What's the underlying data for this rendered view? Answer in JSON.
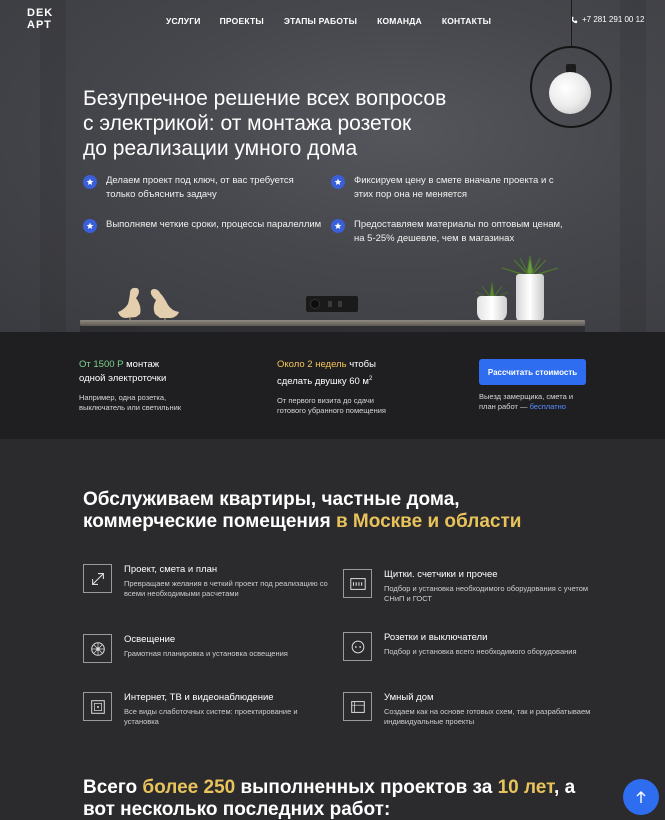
{
  "header": {
    "logo_line1": "DEK",
    "logo_line2": "АРТ",
    "nav": [
      "УСЛУГИ",
      "ПРОЕКТЫ",
      "ЭТАПЫ РАБОТЫ",
      "КОМАНДА",
      "КОНТАКТЫ"
    ],
    "phone": "+7 281 291 00 12"
  },
  "hero": {
    "title_line1": "Безупречное решение всех вопросов",
    "title_line2": "с электрикой: от монтажа розеток",
    "title_line3": "до реализации умного дома",
    "features": [
      "Делаем проект под ключ, от вас требуется только объяснить задачу",
      "Фиксируем цену в смете вначале проекта и с этих пор она не меняется",
      "Выполняем четкие сроки, процессы паралеллим",
      "Предоставляем материалы по оптовым ценам, на 5-25% дешевле, чем в магазинах"
    ]
  },
  "info": {
    "col1_hl": "От 1500 Р",
    "col1_head": " монтаж",
    "col1_head2": "одной электроточки",
    "col1_sub": "Например, одна розетка, выключатель или светильник",
    "col2_hl": "Около 2 недель",
    "col2_head": " чтобы",
    "col2_head2": "сделать двушку 60 м",
    "col2_sup": "2",
    "col2_sub": "От первого визита до сдачи готового убранного помещения",
    "button": "Рассчитать стоимость",
    "col3_sub": "Выезд замерщика, смета и план работ —",
    "col3_link": "бесплатно"
  },
  "services": {
    "title_line1": "Обслуживаем квартиры, частные дома,",
    "title_line2": "коммерческие помещения ",
    "title_hl": "в Москве и области",
    "items": [
      {
        "title": "Проект, смета и план",
        "desc": "Превращаем желания в четкий проект под реализацию со всеми необходимыми расчетами",
        "icon": "resize-arrows-icon"
      },
      {
        "title": "Щитки. счетчики и прочее",
        "desc": "Подбор и установка необходимого оборудования с учетом СНиП и ГОСТ",
        "icon": "panel-icon"
      },
      {
        "title": "Освещение",
        "desc": "Грамотная планировка и установка освещения",
        "icon": "lighting-icon"
      },
      {
        "title": "Розетки и выключатели",
        "desc": "Подбор и установка всего необходимого оборудования",
        "icon": "socket-icon"
      },
      {
        "title": "Интернет, ТВ и видеонаблюдение",
        "desc": "Все виды слаботочных систем: проектирование и установка",
        "icon": "tv-icon"
      },
      {
        "title": "Умный дом",
        "desc": "Создаем как на основе готовых схем, так и разрабатываем индивидуальные проекты",
        "icon": "smart-home-icon"
      }
    ]
  },
  "works": {
    "t1": "Всего ",
    "hl1": "более 250",
    "t2": " выполненных проектов за ",
    "hl2": "10 лет",
    "t3": ", а",
    "line2": "вот несколько последних работ:"
  },
  "colors": {
    "accent_blue": "#2f6df0",
    "gold": "#e8c25b",
    "green": "#7ed48f",
    "bg_dark": "#2b2b2d"
  }
}
